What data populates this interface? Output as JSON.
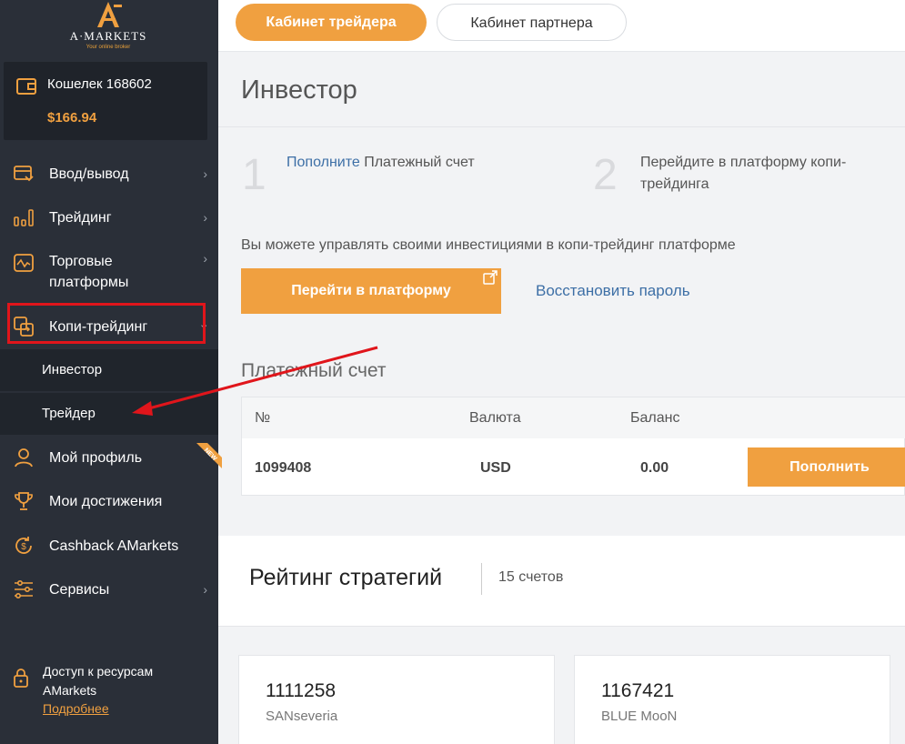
{
  "brand": {
    "logo_text": "A·MARKETS",
    "tagline": "Your online broker"
  },
  "wallet": {
    "name": "Кошелек 168602",
    "balance": "$166.94"
  },
  "sidebar": {
    "items": [
      {
        "label": "Ввод/вывод",
        "icon": "deposit-withdraw-icon"
      },
      {
        "label": "Трейдинг",
        "icon": "bar-chart-icon"
      },
      {
        "label": "Торговые платформы",
        "icon": "platform-chart-icon"
      },
      {
        "label": "Копи-трейдинг",
        "icon": "copy-trading-icon"
      },
      {
        "label": "Мой профиль",
        "icon": "user-icon"
      },
      {
        "label": "Мои достижения",
        "icon": "trophy-icon"
      },
      {
        "label": "Cashback AMarkets",
        "icon": "cashback-icon"
      },
      {
        "label": "Сервисы",
        "icon": "sliders-icon"
      }
    ],
    "sub_items": [
      "Инвестор",
      "Трейдер"
    ],
    "new_badge": "NEW",
    "access": {
      "text": "Доступ к ресурсам AMarkets",
      "link": "Подробнее"
    }
  },
  "header": {
    "tab_trader": "Кабинет трейдера",
    "tab_partner": "Кабинет партнера"
  },
  "main": {
    "title": "Инвестор",
    "steps": [
      {
        "num": "1",
        "link": "Пополните",
        "text": " Платежный счет"
      },
      {
        "num": "2",
        "text": "Перейдите в платформу копи-трейдинга"
      }
    ],
    "info": "Вы можете управлять своими инвестициями в копи-трейдинг платформе",
    "go_button": "Перейти в платформу",
    "restore_link": "Восстановить пароль",
    "account_section": "Платежный счет",
    "table": {
      "headers": [
        "№",
        "Валюта",
        "Баланс"
      ],
      "row": {
        "number": "1099408",
        "currency": "USD",
        "balance": "0.00"
      },
      "topup_button": "Пополнить"
    },
    "rating": {
      "title": "Рейтинг стратегий",
      "count": "15 счетов",
      "cards": [
        {
          "id": "1111258",
          "name": "SANseveria"
        },
        {
          "id": "1167421",
          "name": "BLUE MooN"
        }
      ]
    }
  },
  "colors": {
    "accent": "#f0a040",
    "sidebar_bg": "#2a2f38",
    "link": "#3d6fa6",
    "highlight": "#e0151b"
  }
}
